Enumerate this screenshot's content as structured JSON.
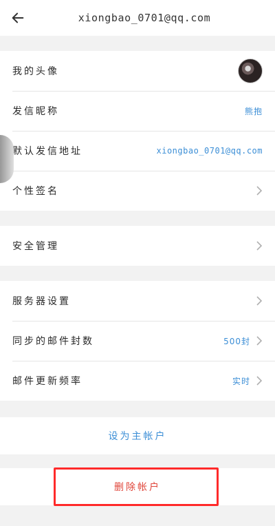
{
  "header": {
    "title": "xiongbao_0701@qq.com",
    "back_icon": "arrow-left-icon"
  },
  "profile": {
    "avatar_label": "我的头像",
    "nickname_label": "发信昵称",
    "nickname_value": "熊抱",
    "sender_label": "默认发信地址",
    "sender_value": "xiongbao_0701@qq.com",
    "signature_label": "个性签名"
  },
  "security": {
    "label": "安全管理"
  },
  "server": {
    "server_label": "服务器设置",
    "sync_label": "同步的邮件封数",
    "sync_value": "500封",
    "freq_label": "邮件更新频率",
    "freq_value": "实时"
  },
  "actions": {
    "set_primary": "设为主帐户",
    "delete": "删除帐户"
  },
  "colors": {
    "accent": "#3b8ed6",
    "danger": "#e0453a",
    "highlight": "#ff2a2a"
  }
}
